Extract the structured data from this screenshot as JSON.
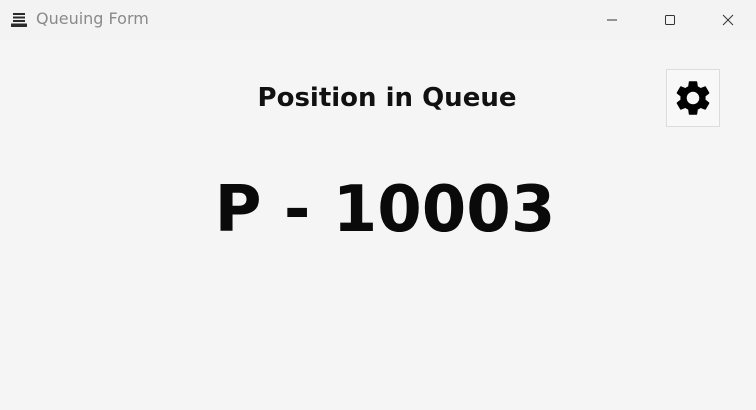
{
  "window": {
    "title": "Queuing Form",
    "icon": "stacked-layers-icon",
    "controls": {
      "minimize": "minimize-icon",
      "maximize": "maximize-icon",
      "close": "close-icon"
    }
  },
  "main": {
    "heading": "Position in Queue",
    "queue_number": "P - 10003",
    "settings_icon": "gear-icon"
  },
  "colors": {
    "background": "#f5f5f5",
    "text": "#111111",
    "title_text": "#8a8a8a"
  }
}
